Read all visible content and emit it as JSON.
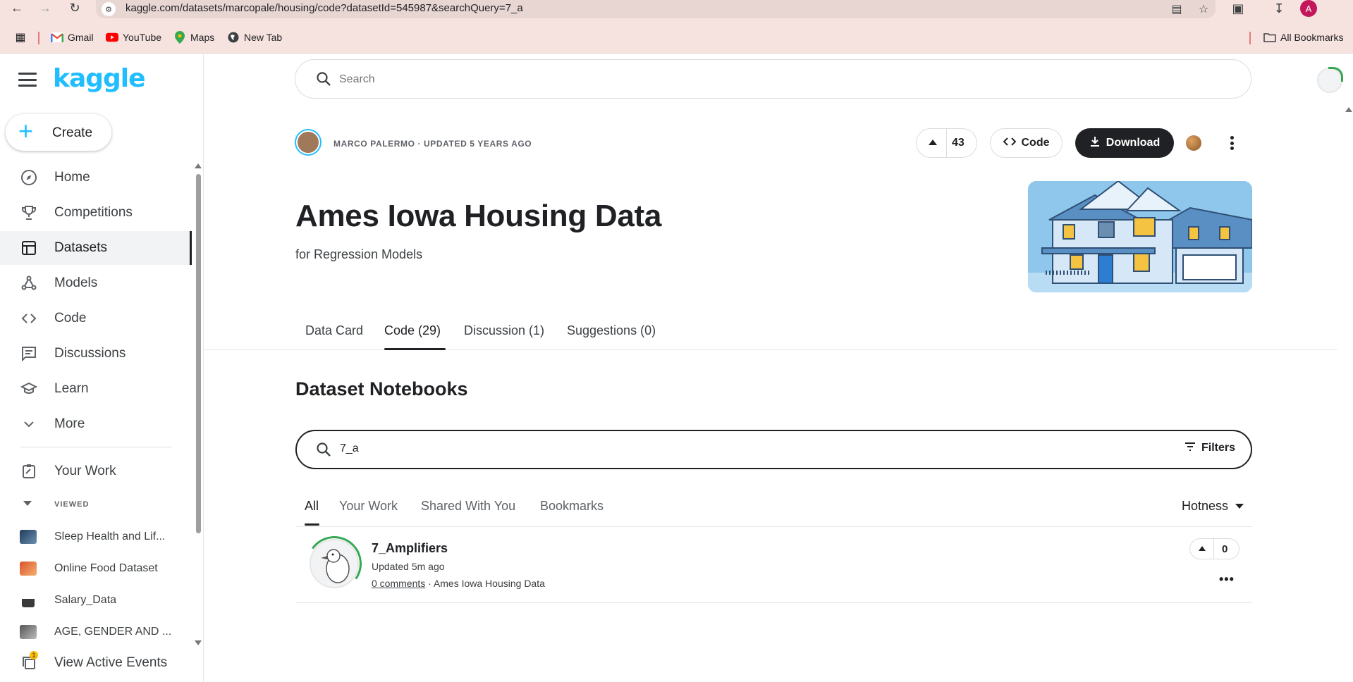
{
  "browser": {
    "url": "kaggle.com/datasets/marcopale/housing/code?datasetId=545987&searchQuery=7_a",
    "profile_initial": "A",
    "bookmarks": [
      {
        "label": "Gmail",
        "icon": "gmail-icon"
      },
      {
        "label": "YouTube",
        "icon": "youtube-icon"
      },
      {
        "label": "Maps",
        "icon": "maps-icon"
      },
      {
        "label": "New Tab",
        "icon": "globe-icon"
      }
    ],
    "all_bookmarks": "All Bookmarks"
  },
  "sidebar": {
    "logo": "kaggle",
    "create_label": "Create",
    "nav": [
      {
        "label": "Home",
        "icon": "compass-icon"
      },
      {
        "label": "Competitions",
        "icon": "trophy-icon"
      },
      {
        "label": "Datasets",
        "icon": "table-icon"
      },
      {
        "label": "Models",
        "icon": "models-icon"
      },
      {
        "label": "Code",
        "icon": "code-icon"
      },
      {
        "label": "Discussions",
        "icon": "discussion-icon"
      },
      {
        "label": "Learn",
        "icon": "school-icon"
      },
      {
        "label": "More",
        "icon": "chevron-down-icon"
      }
    ],
    "your_work": "Your Work",
    "viewed_label": "VIEWED",
    "recent": [
      {
        "label": "Sleep Health and Lif..."
      },
      {
        "label": "Online Food Dataset"
      },
      {
        "label": "Salary_Data"
      },
      {
        "label": "AGE, GENDER AND ..."
      }
    ],
    "view_active_events": "View Active Events",
    "events_badge": "1"
  },
  "header": {
    "search_placeholder": "Search"
  },
  "dataset": {
    "owner_line": "MARCO PALERMO · UPDATED 5 YEARS AGO",
    "upvotes": "43",
    "code_label": "Code",
    "download_label": "Download",
    "title": "Ames Iowa Housing Data",
    "subtitle": "for Regression Models",
    "tabs": [
      {
        "label": "Data Card"
      },
      {
        "label": "Code (29)"
      },
      {
        "label": "Discussion (1)"
      },
      {
        "label": "Suggestions (0)"
      }
    ]
  },
  "notebooks": {
    "section_title": "Dataset Notebooks",
    "search_value": "7_a",
    "filters_label": "Filters",
    "sub_tabs": [
      {
        "label": "All"
      },
      {
        "label": "Your Work"
      },
      {
        "label": "Shared With You"
      },
      {
        "label": "Bookmarks"
      }
    ],
    "sort_label": "Hotness",
    "items": [
      {
        "title": "7_Amplifiers",
        "updated": "Updated 5m ago",
        "comments": "0 comments",
        "dataset": "Ames Iowa Housing Data",
        "votes": "0"
      }
    ]
  },
  "colors": {
    "kaggle_blue": "#20beff",
    "download_bg": "#202124",
    "chrome_bg": "#f6e3df"
  }
}
